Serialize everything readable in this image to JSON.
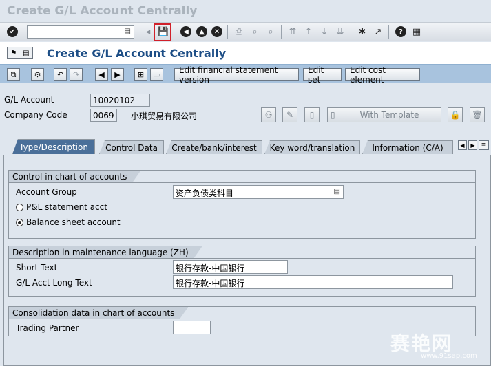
{
  "window": {
    "title": "Create G/L Account Centrally"
  },
  "toolbar": {
    "enter_icon": "checkmark-icon",
    "command_field_value": "",
    "save_icon": "floppy-save-icon"
  },
  "header": {
    "page_title": "Create G/L Account Centrally"
  },
  "app_toolbar": {
    "financial_statement_version": "Edit financial statement version",
    "edit_set": "Edit set",
    "edit_cost_element": "Edit cost element"
  },
  "account": {
    "gl_account_label": "G/L Account",
    "gl_account_value": "10020102",
    "company_code_label": "Company Code",
    "company_code_value": "0069",
    "company_name": "小琪贸易有限公司",
    "with_template": "With Template"
  },
  "tabs": [
    {
      "label": "Type/Description",
      "active": true
    },
    {
      "label": "Control Data",
      "active": false
    },
    {
      "label": "Create/bank/interest",
      "active": false
    },
    {
      "label": "Key word/translation",
      "active": false
    },
    {
      "label": "Information (C/A)",
      "active": false
    }
  ],
  "control_group": {
    "title": "Control in chart of accounts",
    "account_group_label": "Account Group",
    "account_group_value": "资产负债类科目",
    "pl_label": "P&L statement acct",
    "bs_label": "Balance sheet account",
    "selected": "Balance sheet account"
  },
  "description_group": {
    "title": "Description in maintenance language (ZH)",
    "short_text_label": "Short Text",
    "short_text_value": "银行存款-中国银行",
    "long_text_label": "G/L Acct Long Text",
    "long_text_value": "银行存款-中国银行"
  },
  "consolidation_group": {
    "title": "Consolidation data in chart of accounts",
    "trading_partner_label": "Trading Partner",
    "trading_partner_value": ""
  },
  "watermark": {
    "logo": "赛艳网",
    "url": "www.91sap.com"
  }
}
